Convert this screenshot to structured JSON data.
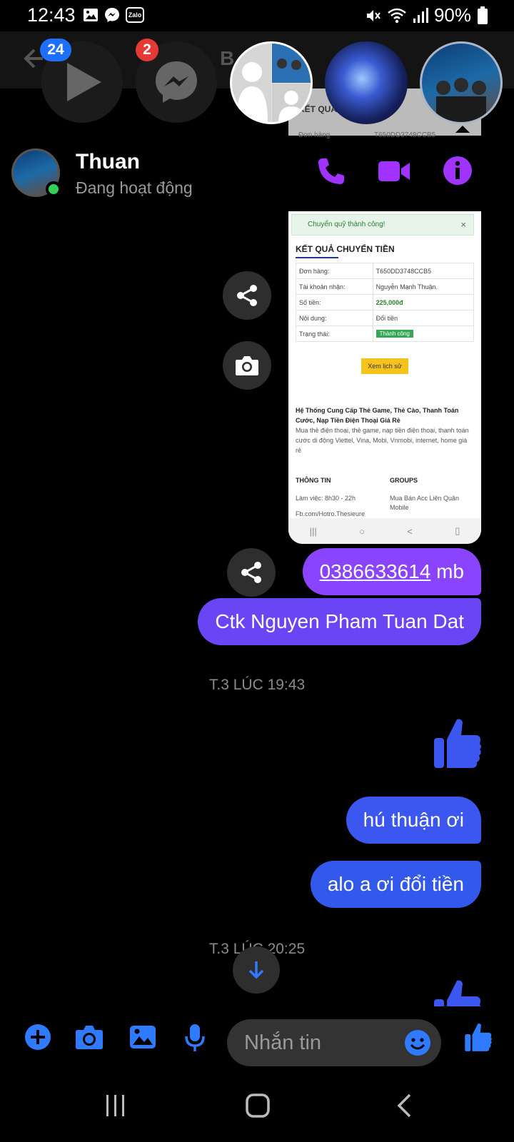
{
  "status_bar": {
    "time": "12:43",
    "battery": "90%",
    "left_icons": [
      "image-icon",
      "messenger-icon",
      "zalo-icon"
    ],
    "zalo_text": "Zalo",
    "right_icons": [
      "mute-icon",
      "wifi-icon",
      "signal-icon",
      "battery-icon"
    ]
  },
  "background_header": {
    "title_fragment": "B",
    "card_title": "KẾT QUẢ C",
    "card_row_label": "Đơn hàng",
    "card_row_value": "T650DD3748CCB5"
  },
  "chat_heads": {
    "badge_count_1": "24",
    "badge_count_2": "2"
  },
  "conversation": {
    "contact_name": "Thuan",
    "contact_status": "Đang hoạt động",
    "colors": {
      "accent": "#a033ff",
      "online": "#31d158",
      "bubble_purple": "#8a43ff",
      "bubble_violet": "#6a45f5",
      "bubble_blue": "#3b57f0"
    }
  },
  "screenshot_message": {
    "toast": "Chuyển quỹ thành công!",
    "heading": "KẾT QUẢ CHUYỂN TIỀN",
    "rows": [
      {
        "label": "Đơn hàng:",
        "value": "T650DD3748CCB5"
      },
      {
        "label": "Tài khoản nhận:",
        "value": "Nguyễn Mạnh Thuận."
      },
      {
        "label": "Số tiền:",
        "value": "225,000đ"
      },
      {
        "label": "Nội dung:",
        "value": "Đổi tiền"
      },
      {
        "label": "Trạng thái:",
        "value": "Thành công"
      }
    ],
    "history_button": "Xem lịch sử",
    "about_title": "Hệ Thống Cung Cấp Thẻ Game, Thẻ Cào, Thanh Toán Cước, Nạp Tiền Điện Thoại Giá Rẻ",
    "about_body": "Mua thẻ điện thoại, thẻ game, nạp tiền điện thoại, thanh toán cước di động Viettel, Vina, Mobi, Vnmobi, internet, home giá rẻ",
    "info_title": "THÔNG TIN",
    "info_line_1": "Làm việc: 8h30 - 22h",
    "info_line_2": "Fb.com/Hotro.Thesieure",
    "groups_title": "GROUPS",
    "groups_line_1": "Mua Bán Acc Liên Quân",
    "groups_line_2": "Mobile",
    "nav_recents": "|||",
    "nav_home": "○",
    "nav_back": "<",
    "nav_rotate": "▯"
  },
  "messages": {
    "phone_number": "0386633614",
    "phone_suffix": " mb",
    "ctk": "Ctk Nguyen Pham Tuan Dat",
    "timestamp_1": "T.3 LÚC 19:43",
    "hu": "hú thuận ơi",
    "alo": "alo a ơi đổi tiền",
    "timestamp_2": "T.3 LÚC 20:25"
  },
  "composer": {
    "placeholder": "Nhắn tin"
  }
}
